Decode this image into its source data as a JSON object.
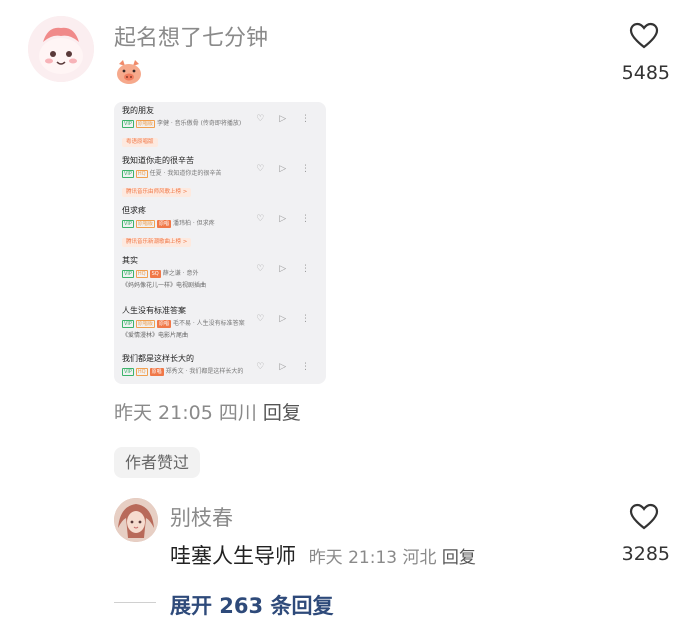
{
  "comment": {
    "username": "起名想了七分钟",
    "likes": "5485",
    "meta_time": "昨天 21:05",
    "meta_location": "四川",
    "meta_reply": "回复",
    "author_badge": "作者赞过"
  },
  "screenshot": {
    "songs": [
      {
        "title": "我的朋友",
        "meta": "李健 · 音乐傲骨 (传奇即将播放)",
        "tags": [
          "VIP",
          "原唱版"
        ],
        "note": "粤语原唱版"
      },
      {
        "title": "我知道你走的很辛苦",
        "meta": "任夏 · 我知道你走的很辛苦",
        "tags": [
          "VIP",
          "HQ"
        ],
        "note": "腾讯音乐由师风歌上榜 >"
      },
      {
        "title": "但求疼",
        "meta": "潘玮柏 · 但求疼",
        "tags": [
          "VIP",
          "原唱版",
          "原唱"
        ],
        "note": "腾讯音乐新潮歌曲上榜 >"
      },
      {
        "title": "其实",
        "meta": "薛之谦 · 意外",
        "tags": [
          "VIP",
          "HQ",
          "SQ"
        ],
        "desc": "《妈妈像花儿一样》电视剧插曲"
      },
      {
        "title": "人生没有标准答案",
        "meta": "毛不易 · 人生没有标准答案",
        "tags": [
          "VIP",
          "原唱版",
          "原唱"
        ],
        "desc": "《爱情漫林》电影片尾曲"
      },
      {
        "title": "我们都是这样长大的",
        "meta": "郑秀文 · 我们都是这样长大的",
        "tags": [
          "VIP",
          "HQ",
          "原唱"
        ]
      }
    ],
    "actions": "♡ ▷ ⋮"
  },
  "reply": {
    "username": "别枝春",
    "text": "哇塞人生导师",
    "time": "昨天 21:13",
    "location": "河北",
    "reply_label": "回复",
    "likes": "3285"
  },
  "expand": {
    "label": "展开 263 条回复"
  }
}
